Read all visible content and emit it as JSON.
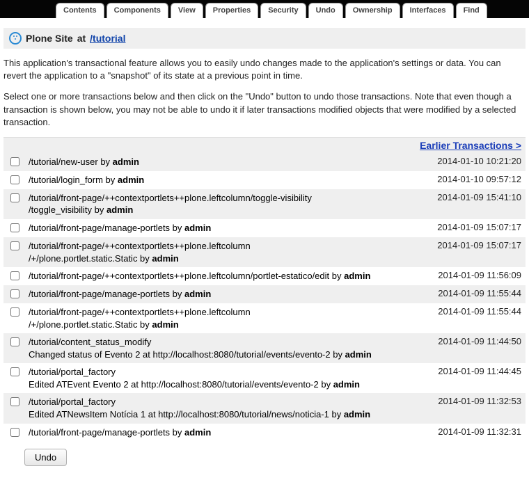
{
  "tabs": [
    {
      "label": "Contents",
      "active": false
    },
    {
      "label": "Components",
      "active": false
    },
    {
      "label": "View",
      "active": false
    },
    {
      "label": "Properties",
      "active": false
    },
    {
      "label": "Security",
      "active": false
    },
    {
      "label": "Undo",
      "active": true
    },
    {
      "label": "Ownership",
      "active": false
    },
    {
      "label": "Interfaces",
      "active": false
    },
    {
      "label": "Find",
      "active": false
    }
  ],
  "heading": {
    "object_type": "Plone Site",
    "at": "at",
    "path": "/tutorial"
  },
  "desc1": "This application's transactional feature allows you to easily undo changes made to the application's settings or data. You can revert the application to a \"snapshot\" of its state at a previous point in time.",
  "desc2": "Select one or more transactions below and then click on the \"Undo\" button to undo those transactions. Note that even though a transaction is shown below, you may not be able to undo it if later transactions modified objects that were modified by a selected transaction.",
  "earlier_label": "Earlier Transactions >",
  "by_word": "by",
  "transactions": [
    {
      "path": "/tutorial/new-user",
      "extra": null,
      "user": "admin",
      "date": "2014-01-10 10:21:20"
    },
    {
      "path": "/tutorial/login_form",
      "extra": null,
      "user": "admin",
      "date": "2014-01-10 09:57:12"
    },
    {
      "path": "/tutorial/front-page/++contextportlets++plone.leftcolumn/toggle-visibility",
      "extra": "/toggle_visibility",
      "user": "admin",
      "date": "2014-01-09 15:41:10"
    },
    {
      "path": "/tutorial/front-page/manage-portlets",
      "extra": null,
      "user": "admin",
      "date": "2014-01-09 15:07:17"
    },
    {
      "path": "/tutorial/front-page/++contextportlets++plone.leftcolumn",
      "extra": "/+/plone.portlet.static.Static",
      "user": "admin",
      "date": "2014-01-09 15:07:17"
    },
    {
      "path": "/tutorial/front-page/++contextportlets++plone.leftcolumn/portlet-estatico/edit",
      "extra": null,
      "user": "admin",
      "date": "2014-01-09 11:56:09"
    },
    {
      "path": "/tutorial/front-page/manage-portlets",
      "extra": null,
      "user": "admin",
      "date": "2014-01-09 11:55:44"
    },
    {
      "path": "/tutorial/front-page/++contextportlets++plone.leftcolumn",
      "extra": "/+/plone.portlet.static.Static",
      "user": "admin",
      "date": "2014-01-09 11:55:44"
    },
    {
      "path": "/tutorial/content_status_modify",
      "extra": "Changed status of Evento 2 at http://localhost:8080/tutorial/events/evento-2",
      "user": "admin",
      "date": "2014-01-09 11:44:50"
    },
    {
      "path": "/tutorial/portal_factory",
      "extra": "Edited ATEvent Evento 2 at http://localhost:8080/tutorial/events/evento-2",
      "user": "admin",
      "date": "2014-01-09 11:44:45"
    },
    {
      "path": "/tutorial/portal_factory",
      "extra": "Edited ATNewsItem Notícia 1 at http://localhost:8080/tutorial/news/noticia-1",
      "user": "admin",
      "date": "2014-01-09 11:32:53"
    },
    {
      "path": "/tutorial/front-page/manage-portlets",
      "extra": null,
      "user": "admin",
      "date": "2014-01-09 11:32:31"
    }
  ],
  "undo_button": "Undo"
}
